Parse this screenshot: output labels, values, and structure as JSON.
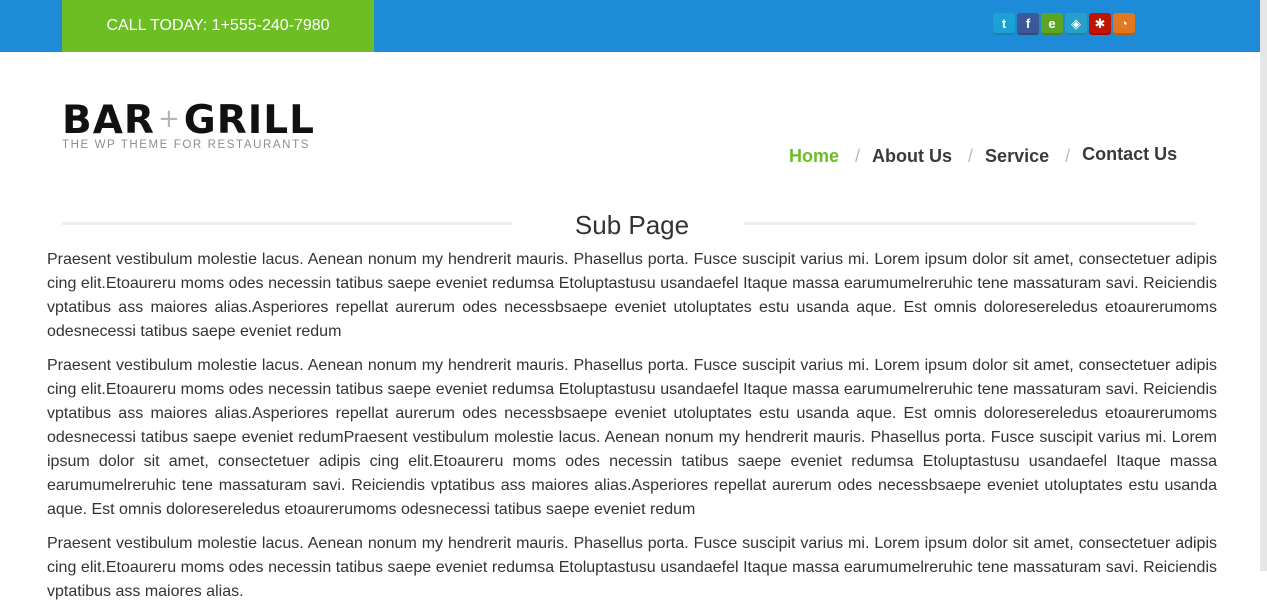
{
  "topbar": {
    "call_text": "CALL TODAY: 1+555-240-7980",
    "social": [
      {
        "icon": "twitter-icon",
        "glyph": "t",
        "color": "#1ca0d6"
      },
      {
        "icon": "facebook-icon",
        "glyph": "f",
        "color": "#3b5998"
      },
      {
        "icon": "evernote-icon",
        "glyph": "e",
        "color": "#5ba525"
      },
      {
        "icon": "foursquare-icon",
        "glyph": "◈",
        "color": "#25a0ca"
      },
      {
        "icon": "yelp-icon",
        "glyph": "✱",
        "color": "#c41200"
      },
      {
        "icon": "rss-icon",
        "glyph": "◔",
        "color": "#e2771d"
      }
    ]
  },
  "logo": {
    "word1": "BAR",
    "plus": "+",
    "word2": "GRILL",
    "tagline": "THE WP THEME FOR RESTAURANTS"
  },
  "nav": {
    "items": [
      "Home",
      "About Us",
      "Service",
      "Contact Us"
    ],
    "separator": "/",
    "active_color": "#6dbd25"
  },
  "page": {
    "title": "Sub Page",
    "paragraphs": [
      "Praesent vestibulum molestie lacus. Aenean nonum my hendrerit mauris. Phasellus porta. Fusce suscipit varius mi. Lorem ipsum dolor sit amet, consectetuer adipis cing elit.Etoaureru moms odes necessin tatibus saepe eveniet redumsa Etoluptastusu usandaefel Itaque massa earumumelreruhic tene massaturam savi. Reiciendis vptatibus ass maiores alias.Asperiores repellat aurerum odes necessbsaepe eveniet utoluptates estu usanda aque. Est omnis doloresereledus etoaurerumoms odesnecessi tatibus saepe eveniet redum",
      "Praesent vestibulum molestie lacus. Aenean nonum my hendrerit mauris. Phasellus porta. Fusce suscipit varius mi. Lorem ipsum dolor sit amet, consectetuer adipis cing elit.Etoaureru moms odes necessin tatibus saepe eveniet redumsa Etoluptastusu usandaefel Itaque massa earumumelreruhic tene massaturam savi. Reiciendis vptatibus ass maiores alias.Asperiores repellat aurerum odes necessbsaepe eveniet utoluptates estu usanda aque. Est omnis doloresereledus etoaurerumoms odesnecessi tatibus saepe eveniet redumPraesent vestibulum molestie lacus. Aenean nonum my hendrerit mauris. Phasellus porta. Fusce suscipit varius mi. Lorem ipsum dolor sit amet, consectetuer adipis cing elit.Etoaureru moms odes necessin tatibus saepe eveniet redumsa Etoluptastusu usandaefel Itaque massa earumumelreruhic tene massaturam savi. Reiciendis vptatibus ass maiores alias.Asperiores repellat aurerum odes necessbsaepe eveniet utoluptates estu usanda aque. Est omnis doloresereledus etoaurerumoms odesnecessi tatibus saepe eveniet redum",
      "Praesent vestibulum molestie lacus. Aenean nonum my hendrerit mauris. Phasellus porta. Fusce suscipit varius mi. Lorem ipsum dolor sit amet, consectetuer adipis cing elit.Etoaureru moms odes necessin tatibus saepe eveniet redumsa Etoluptastusu usandaefel Itaque massa earumumelreruhic tene massaturam savi. Reiciendis vptatibus ass maiores alias."
    ]
  }
}
